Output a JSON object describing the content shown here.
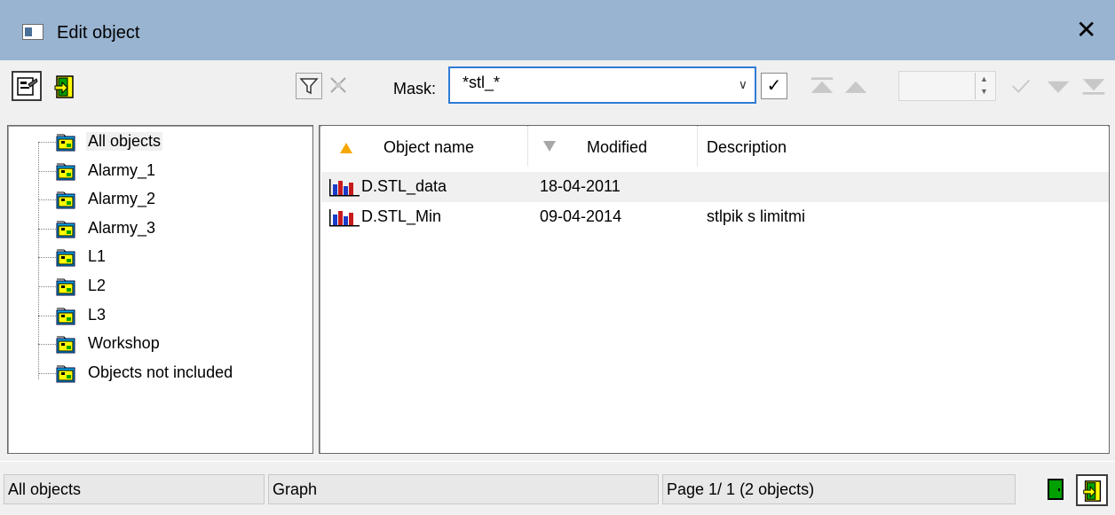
{
  "window": {
    "title": "Edit object",
    "close_glyph": "✕"
  },
  "toolbar": {
    "mask_label": "Mask:",
    "mask_value": "*stl_*",
    "apply_glyph": "✓",
    "icons": [
      "properties-icon",
      "exit-icon",
      "filter-icon",
      "clear-filter-icon",
      "first-page-icon",
      "prev-page-icon",
      "next-page-icon",
      "last-page-icon"
    ]
  },
  "tree": {
    "items": [
      {
        "label": "All objects",
        "selected": true
      },
      {
        "label": "Alarmy_1"
      },
      {
        "label": "Alarmy_2"
      },
      {
        "label": "Alarmy_3"
      },
      {
        "label": "L1"
      },
      {
        "label": "L2"
      },
      {
        "label": "L3"
      },
      {
        "label": "Workshop"
      },
      {
        "label": "Objects not included"
      }
    ]
  },
  "grid": {
    "columns": [
      "Object name",
      "Modified",
      "Description"
    ],
    "rows": [
      {
        "name": "D.STL_data",
        "modified": "18-04-2011",
        "description": ""
      },
      {
        "name": "D.STL_Min",
        "modified": "09-04-2014",
        "description": "stlpik s limitmi"
      }
    ]
  },
  "status": {
    "group": "All objects",
    "type": "Graph",
    "page": "Page  1/ 1   (2 objects)"
  },
  "colors": {
    "titlebar": "#99b4d1",
    "accent": "#2f7bd6",
    "sort_asc": "#f5a800"
  }
}
